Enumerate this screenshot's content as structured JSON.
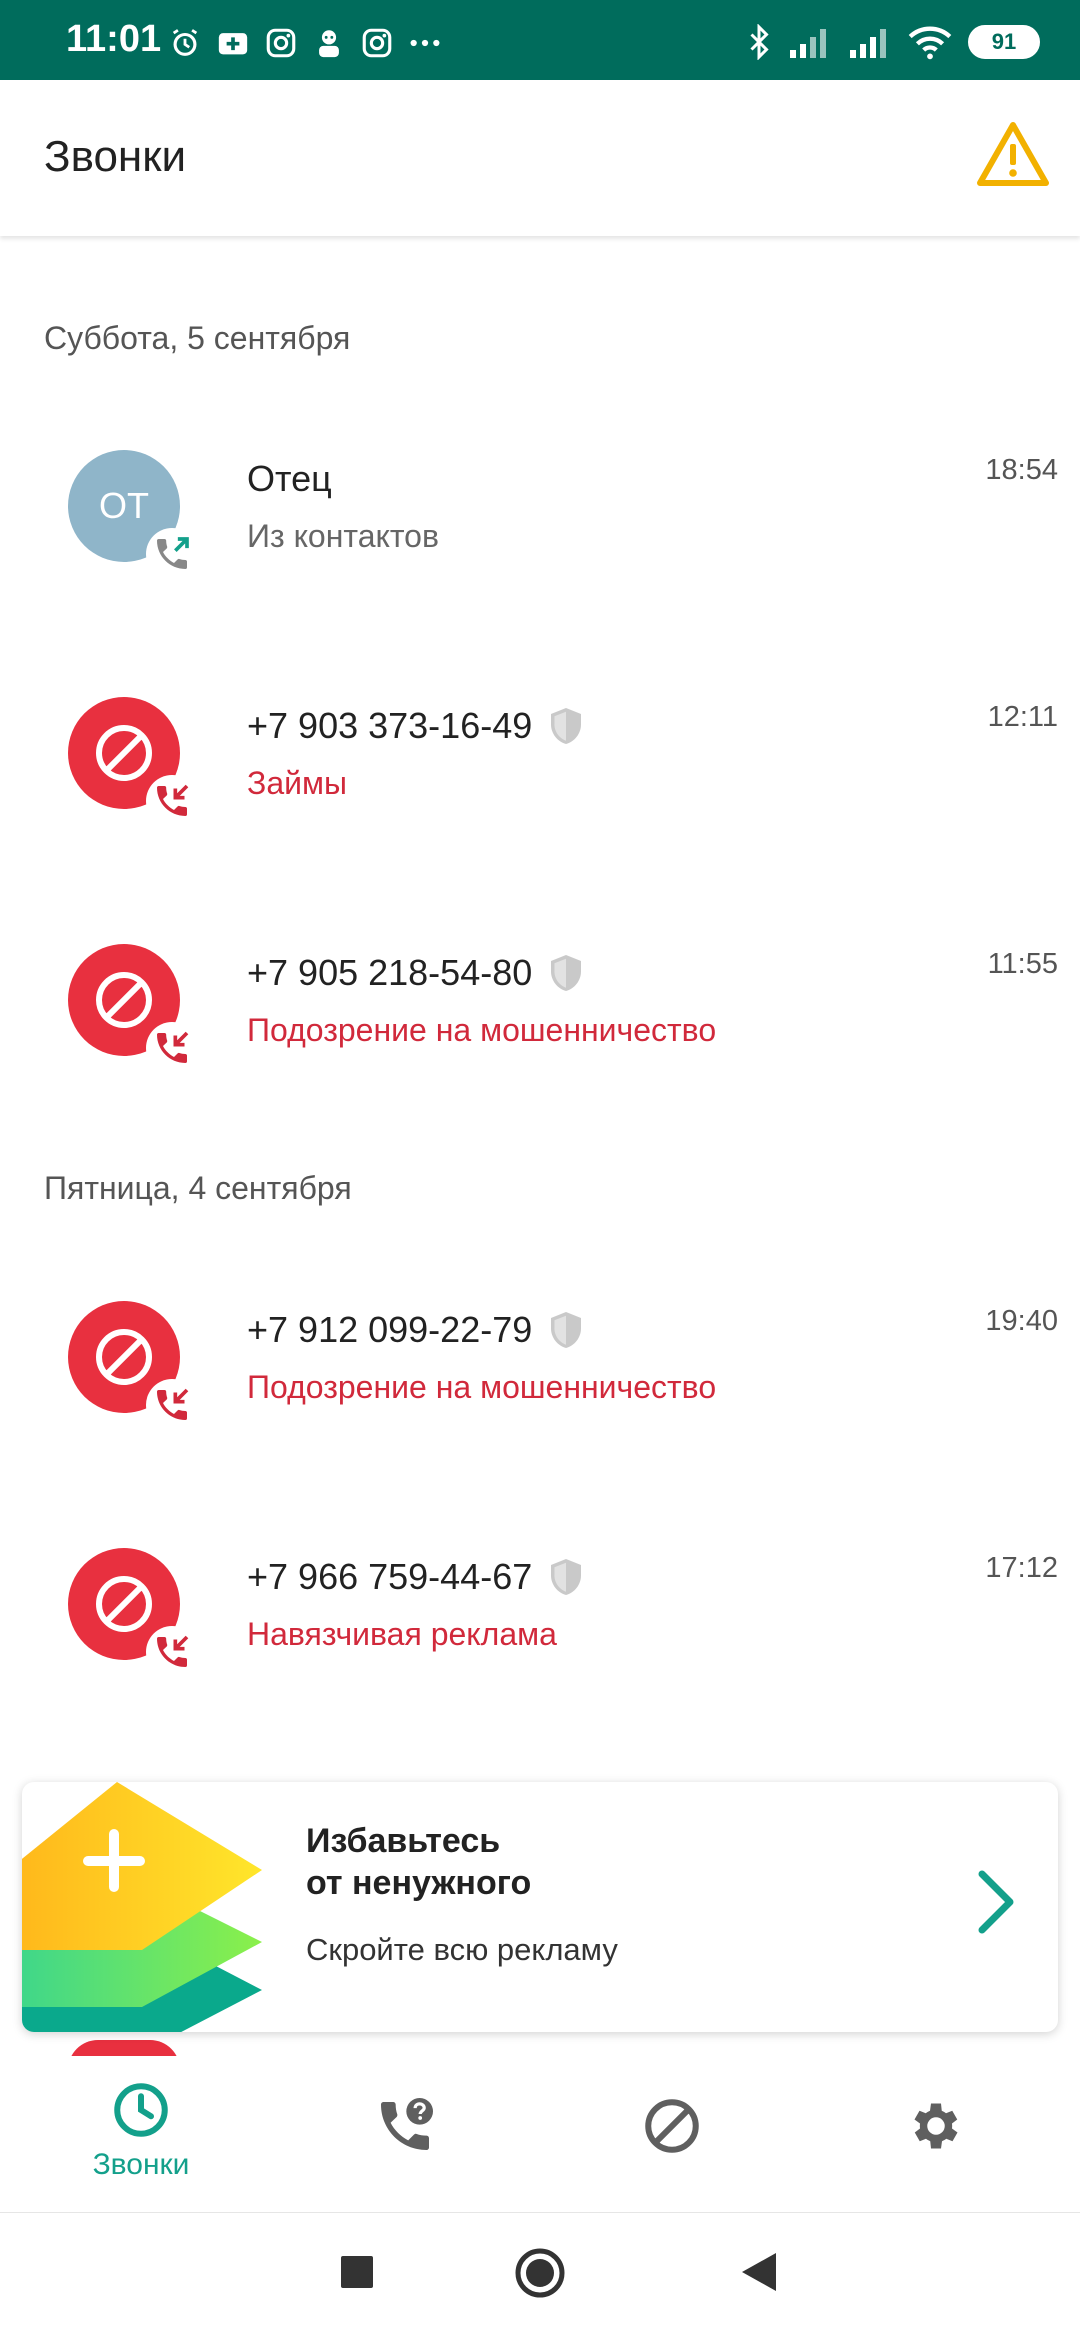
{
  "status_bar": {
    "time": "11:01",
    "battery": "91",
    "icons": [
      "alarm-icon",
      "medical-icon",
      "instagram-icon",
      "character-icon",
      "instagram-icon",
      "more-icon"
    ],
    "right_icons": [
      "bluetooth-icon",
      "signal-icon",
      "signal-icon",
      "wifi-icon",
      "battery-icon"
    ]
  },
  "app_bar": {
    "title": "Звонки",
    "action_icon": "warning-icon"
  },
  "sections": [
    {
      "date": "Суббота, 5 сентября",
      "calls": [
        {
          "title": "Отец",
          "subtitle": "Из контактов",
          "time": "18:54",
          "avatar_text": "ОТ",
          "type": "contact",
          "direction": "outgoing"
        },
        {
          "title": "+7 903 373-16-49",
          "subtitle": "Займы",
          "time": "12:11",
          "type": "blocked",
          "direction": "blocked-incoming"
        },
        {
          "title": "+7 905 218-54-80",
          "subtitle": "Подозрение на мошенничество",
          "time": "11:55",
          "type": "blocked",
          "direction": "blocked-incoming"
        }
      ]
    },
    {
      "date": "Пятница, 4 сентября",
      "calls": [
        {
          "title": "+7 912 099-22-79",
          "subtitle": "Подозрение на мошенничество",
          "time": "19:40",
          "type": "blocked",
          "direction": "blocked-incoming"
        },
        {
          "title": "+7 966 759-44-67",
          "subtitle": "Навязчивая реклама",
          "time": "17:12",
          "type": "blocked",
          "direction": "blocked-incoming"
        }
      ]
    }
  ],
  "promo": {
    "title_line1": "Избавьтесь",
    "title_line2": "от ненужного",
    "subtitle": "Скройте всю рекламу"
  },
  "bottom_nav": {
    "items": [
      {
        "label": "Звонки",
        "icon": "clock-icon",
        "active": true
      },
      {
        "label": "",
        "icon": "phone-question-icon",
        "active": false
      },
      {
        "label": "",
        "icon": "block-icon",
        "active": false
      },
      {
        "label": "",
        "icon": "gear-icon",
        "active": false
      }
    ]
  },
  "system_nav": [
    "recents-button",
    "home-button",
    "back-button"
  ],
  "colors": {
    "status_bar": "#006c5c",
    "accent": "#13a08b",
    "blocked_red": "#e8303f",
    "label_red": "#d1293b",
    "contact_avatar": "#8fb5c9",
    "warning": "#f2b100"
  }
}
